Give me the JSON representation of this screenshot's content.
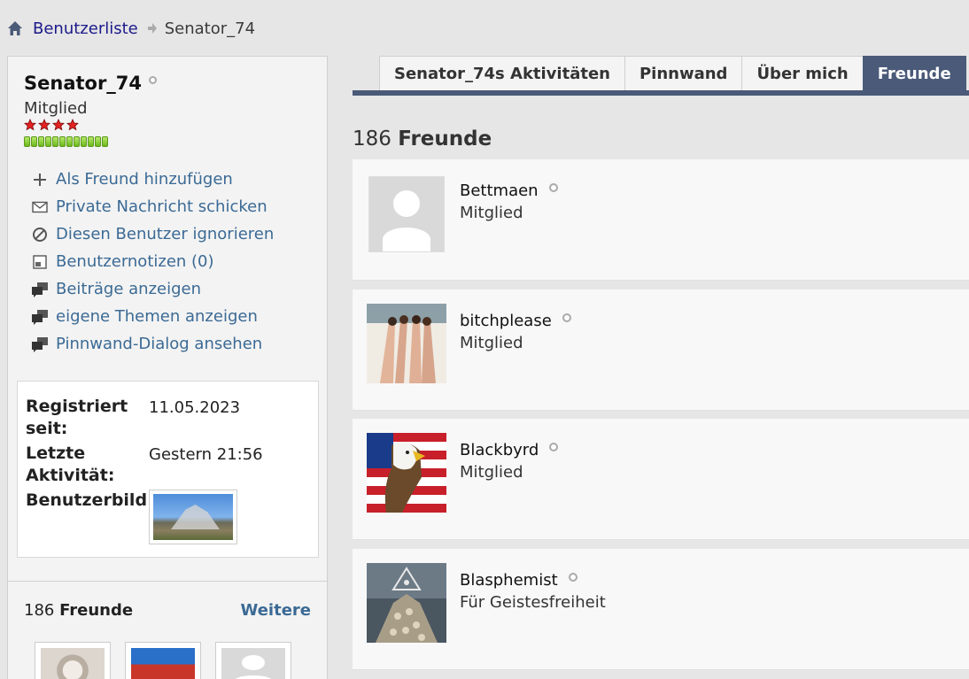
{
  "breadcrumb": {
    "home_icon": "home-icon",
    "link": "Benutzerliste",
    "current": "Senator_74"
  },
  "profile": {
    "username": "Senator_74",
    "rank": "Mitglied",
    "stars": 4,
    "reputation_pips": 12,
    "actions": [
      {
        "label": "Als Freund hinzufügen",
        "icon": "plus-icon"
      },
      {
        "label": "Private Nachricht schicken",
        "icon": "envelope-icon"
      },
      {
        "label": "Diesen Benutzer ignorieren",
        "icon": "block-icon"
      },
      {
        "label": "Benutzernotizen (0)",
        "icon": "note-icon"
      },
      {
        "label": "Beiträge anzeigen",
        "icon": "posts-icon"
      },
      {
        "label": "eigene Themen anzeigen",
        "icon": "threads-icon"
      },
      {
        "label": "Pinnwand-Dialog ansehen",
        "icon": "wall-icon"
      }
    ],
    "info": {
      "registered_label": "Registriert seit:",
      "registered_value": "11.05.2023",
      "last_activity_label": "Letzte Aktivität:",
      "last_activity_value": "Gestern 21:56",
      "avatar_label": "Benutzerbild:"
    },
    "friends_box": {
      "count": "186",
      "label": "Freunde",
      "more": "Weitere"
    }
  },
  "tabs": [
    {
      "label": "Senator_74s Aktivitäten",
      "active": false
    },
    {
      "label": "Pinnwand",
      "active": false
    },
    {
      "label": "Über mich",
      "active": false
    },
    {
      "label": "Freunde",
      "active": true
    }
  ],
  "friends_section": {
    "count": "186",
    "label": "Freunde",
    "friends": [
      {
        "name": "Bettmaen",
        "rank": "Mitglied"
      },
      {
        "name": "bitchplease",
        "rank": "Mitglied"
      },
      {
        "name": "Blackbyrd",
        "rank": "Mitglied"
      },
      {
        "name": "Blasphemist",
        "rank": "Für Geistesfreiheit"
      }
    ]
  },
  "colors": {
    "link": "#3b6a95",
    "tab_active": "#4a5a78",
    "breadcrumb_link": "#1c1a8a"
  }
}
